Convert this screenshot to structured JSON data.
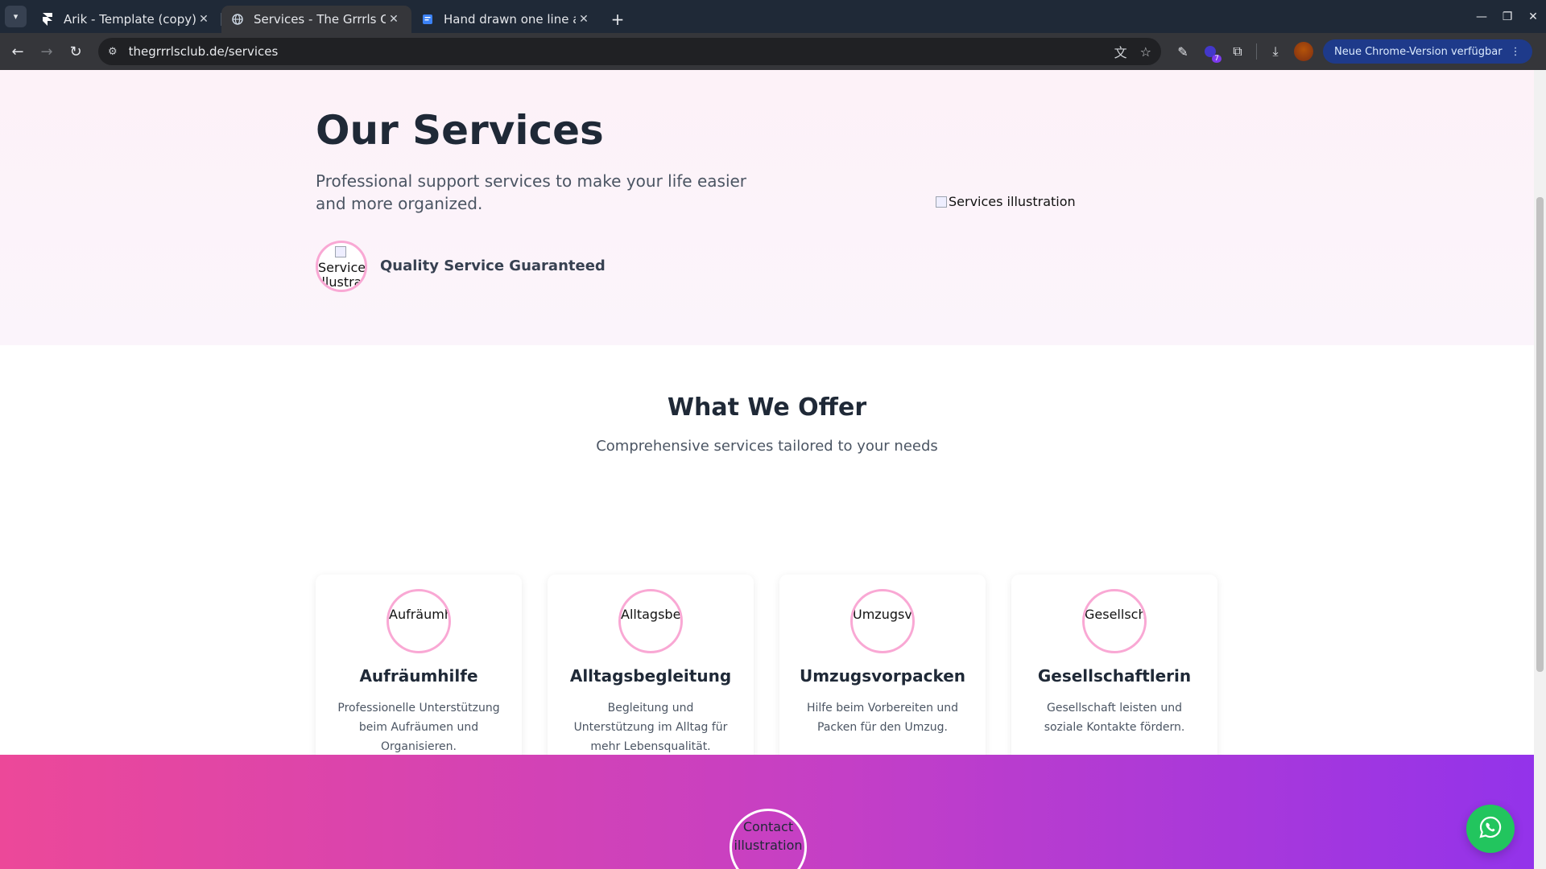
{
  "browser": {
    "tabs": [
      {
        "title": "Arik - Template (copy) – F",
        "favicon": "framer-icon",
        "active": false
      },
      {
        "title": "Services - The Grrrls Club",
        "favicon": "globe-icon",
        "active": true
      },
      {
        "title": "Hand drawn one line art",
        "favicon": "doc-icon",
        "active": false
      }
    ],
    "url": "thegrrrlsclub.de/services",
    "extension_badge": "7",
    "update_label": "Neue Chrome-Version verfügbar"
  },
  "hero": {
    "title": "Our Services",
    "subtitle": "Professional support services to make your life easier and more organized.",
    "badge_alt": "Service illustration",
    "badge_text": "Quality Service Guaranteed",
    "illustration_alt": "Services illustration"
  },
  "offer": {
    "title": "What We Offer",
    "subtitle": "Comprehensive services tailored to your needs",
    "cards": [
      {
        "img_alt": "Aufräumh",
        "title": "Aufräumhilfe",
        "desc": "Professionelle Unterstützung beim Aufräumen und Organisieren."
      },
      {
        "img_alt": "Alltagsbeg",
        "title": "Alltagsbegleitung",
        "desc": "Begleitung und Unterstützung im Alltag für mehr Lebensqualität."
      },
      {
        "img_alt": "Umzugsvo",
        "title": "Umzugsvorpacken",
        "desc": "Hilfe beim Vorbereiten und Packen für den Umzug."
      },
      {
        "img_alt": "Gesellscha",
        "title": "Gesellschaftlerin",
        "desc": "Gesellschaft leisten und soziale Kontakte fördern."
      }
    ]
  },
  "contact": {
    "img_alt": "Contact illustration"
  },
  "colors": {
    "accent_pink": "#ec4899",
    "accent_purple": "#9333ea",
    "whatsapp_green": "#22c55e"
  }
}
